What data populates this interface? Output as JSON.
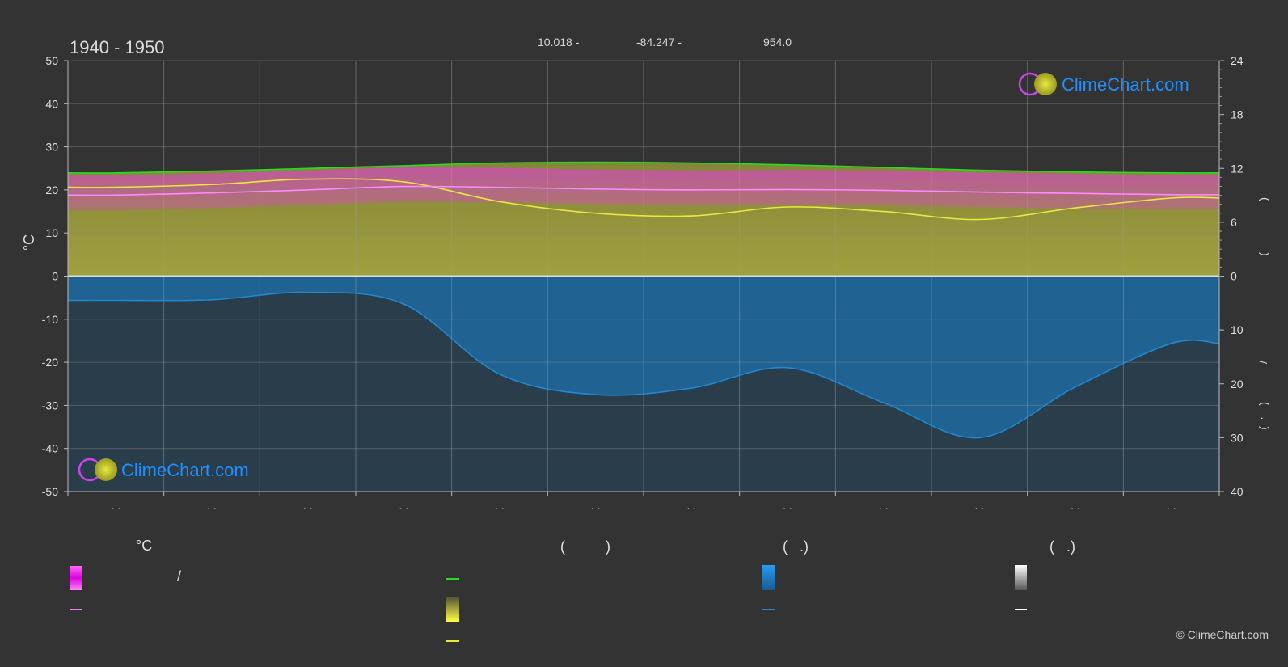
{
  "header": {
    "period": "1940 - 1950",
    "lat": "10.018 -",
    "lon": "-84.247 -",
    "elevation": "954.0"
  },
  "axes": {
    "left_unit": "°C",
    "left_ticks": [
      "50",
      "40",
      "30",
      "20",
      "10",
      "0",
      "-10",
      "-20",
      "-30",
      "-40",
      "-50"
    ],
    "right_top_ticks": [
      "24",
      "18",
      "12",
      "6",
      "0"
    ],
    "right_bottom_ticks": [
      "10",
      "20",
      "30",
      "40"
    ],
    "right_labels": [
      "(",
      ")",
      "(",
      ")",
      "/",
      "(",
      "·",
      ")"
    ],
    "month_marks": [
      ". .",
      ". .",
      ". .",
      ". .",
      ". .",
      ". .",
      ". .",
      ". .",
      ". .",
      ". .",
      ". .",
      ". ."
    ]
  },
  "watermark": {
    "text": "ClimeChart.com"
  },
  "legend": {
    "col1_header": "°C",
    "col1_sep": "/",
    "col2_header": "(          )",
    "col3_header": "(   .)",
    "col4_header": "(   .)"
  },
  "copyright": "© ClimeChart.com",
  "colors": {
    "background": "#333333",
    "daylight": "#22dd22",
    "sunshine": "#e8e840",
    "temperature": "#ff88ff",
    "temp_band": "#dd22dd",
    "rain": "#1e88d0",
    "logo_blue": "#1e90ff"
  },
  "chart_data": {
    "type": "line",
    "title": "1940 - 1950",
    "ylabel": "°C",
    "ylim": [
      -50,
      50
    ],
    "right_top_ylim_hours": [
      0,
      24
    ],
    "right_bottom_ylim_mm": [
      0,
      40
    ],
    "x": [
      "Jan",
      "Feb",
      "Mar",
      "Apr",
      "May",
      "Jun",
      "Jul",
      "Aug",
      "Sep",
      "Oct",
      "Nov",
      "Dec"
    ],
    "series": [
      {
        "role": "daylight_hours",
        "color": "#22dd22",
        "values": [
          11.5,
          11.7,
          12.0,
          12.3,
          12.6,
          12.7,
          12.6,
          12.4,
          12.1,
          11.8,
          11.6,
          11.5
        ]
      },
      {
        "role": "sunshine_hours",
        "color": "#e8e840",
        "values": [
          9.9,
          10.2,
          10.8,
          10.5,
          8.3,
          7.0,
          6.7,
          7.7,
          7.2,
          6.3,
          7.6,
          8.7
        ]
      },
      {
        "role": "mean_temperature_c",
        "color": "#ff88ff",
        "values": [
          18.8,
          19.3,
          20.0,
          20.8,
          20.6,
          20.2,
          20.0,
          20.1,
          19.9,
          19.5,
          19.2,
          18.9
        ]
      },
      {
        "role": "precipitation_mm",
        "color": "#1e88d0",
        "values": [
          4.5,
          4.4,
          3.0,
          5.2,
          18.2,
          22.0,
          20.8,
          17.0,
          23.5,
          30.0,
          20.6,
          12.5
        ]
      }
    ]
  }
}
